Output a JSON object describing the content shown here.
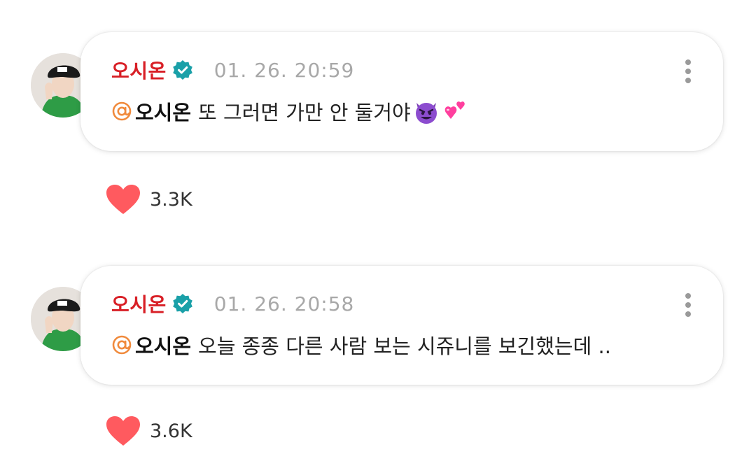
{
  "posts": [
    {
      "author": "오시온",
      "timestamp": "01. 26. 20:59",
      "mention": "오시온",
      "text": "또 그러면 가만 안 둘거야",
      "emojis": [
        "smiling-devil-emoji",
        "two-hearts-emoji"
      ],
      "likes": "3.3K"
    },
    {
      "author": "오시온",
      "timestamp": "01. 26. 20:58",
      "mention": "오시온",
      "text": "오늘 종종 다른 사람 보는 시쥬니를 보긴했는데 ..",
      "emojis": [],
      "likes": "3.6K"
    }
  ],
  "colors": {
    "author_name": "#d81f26",
    "verified_badge": "#1aa0a8",
    "mention_icon": "#f08a3c",
    "heart": "#ff5a5f",
    "timestamp": "#a8a8a8"
  },
  "icons": {
    "verified": "verified-badge-icon",
    "more": "more-vertical-icon",
    "mention": "at-sign-icon",
    "like": "heart-icon"
  }
}
